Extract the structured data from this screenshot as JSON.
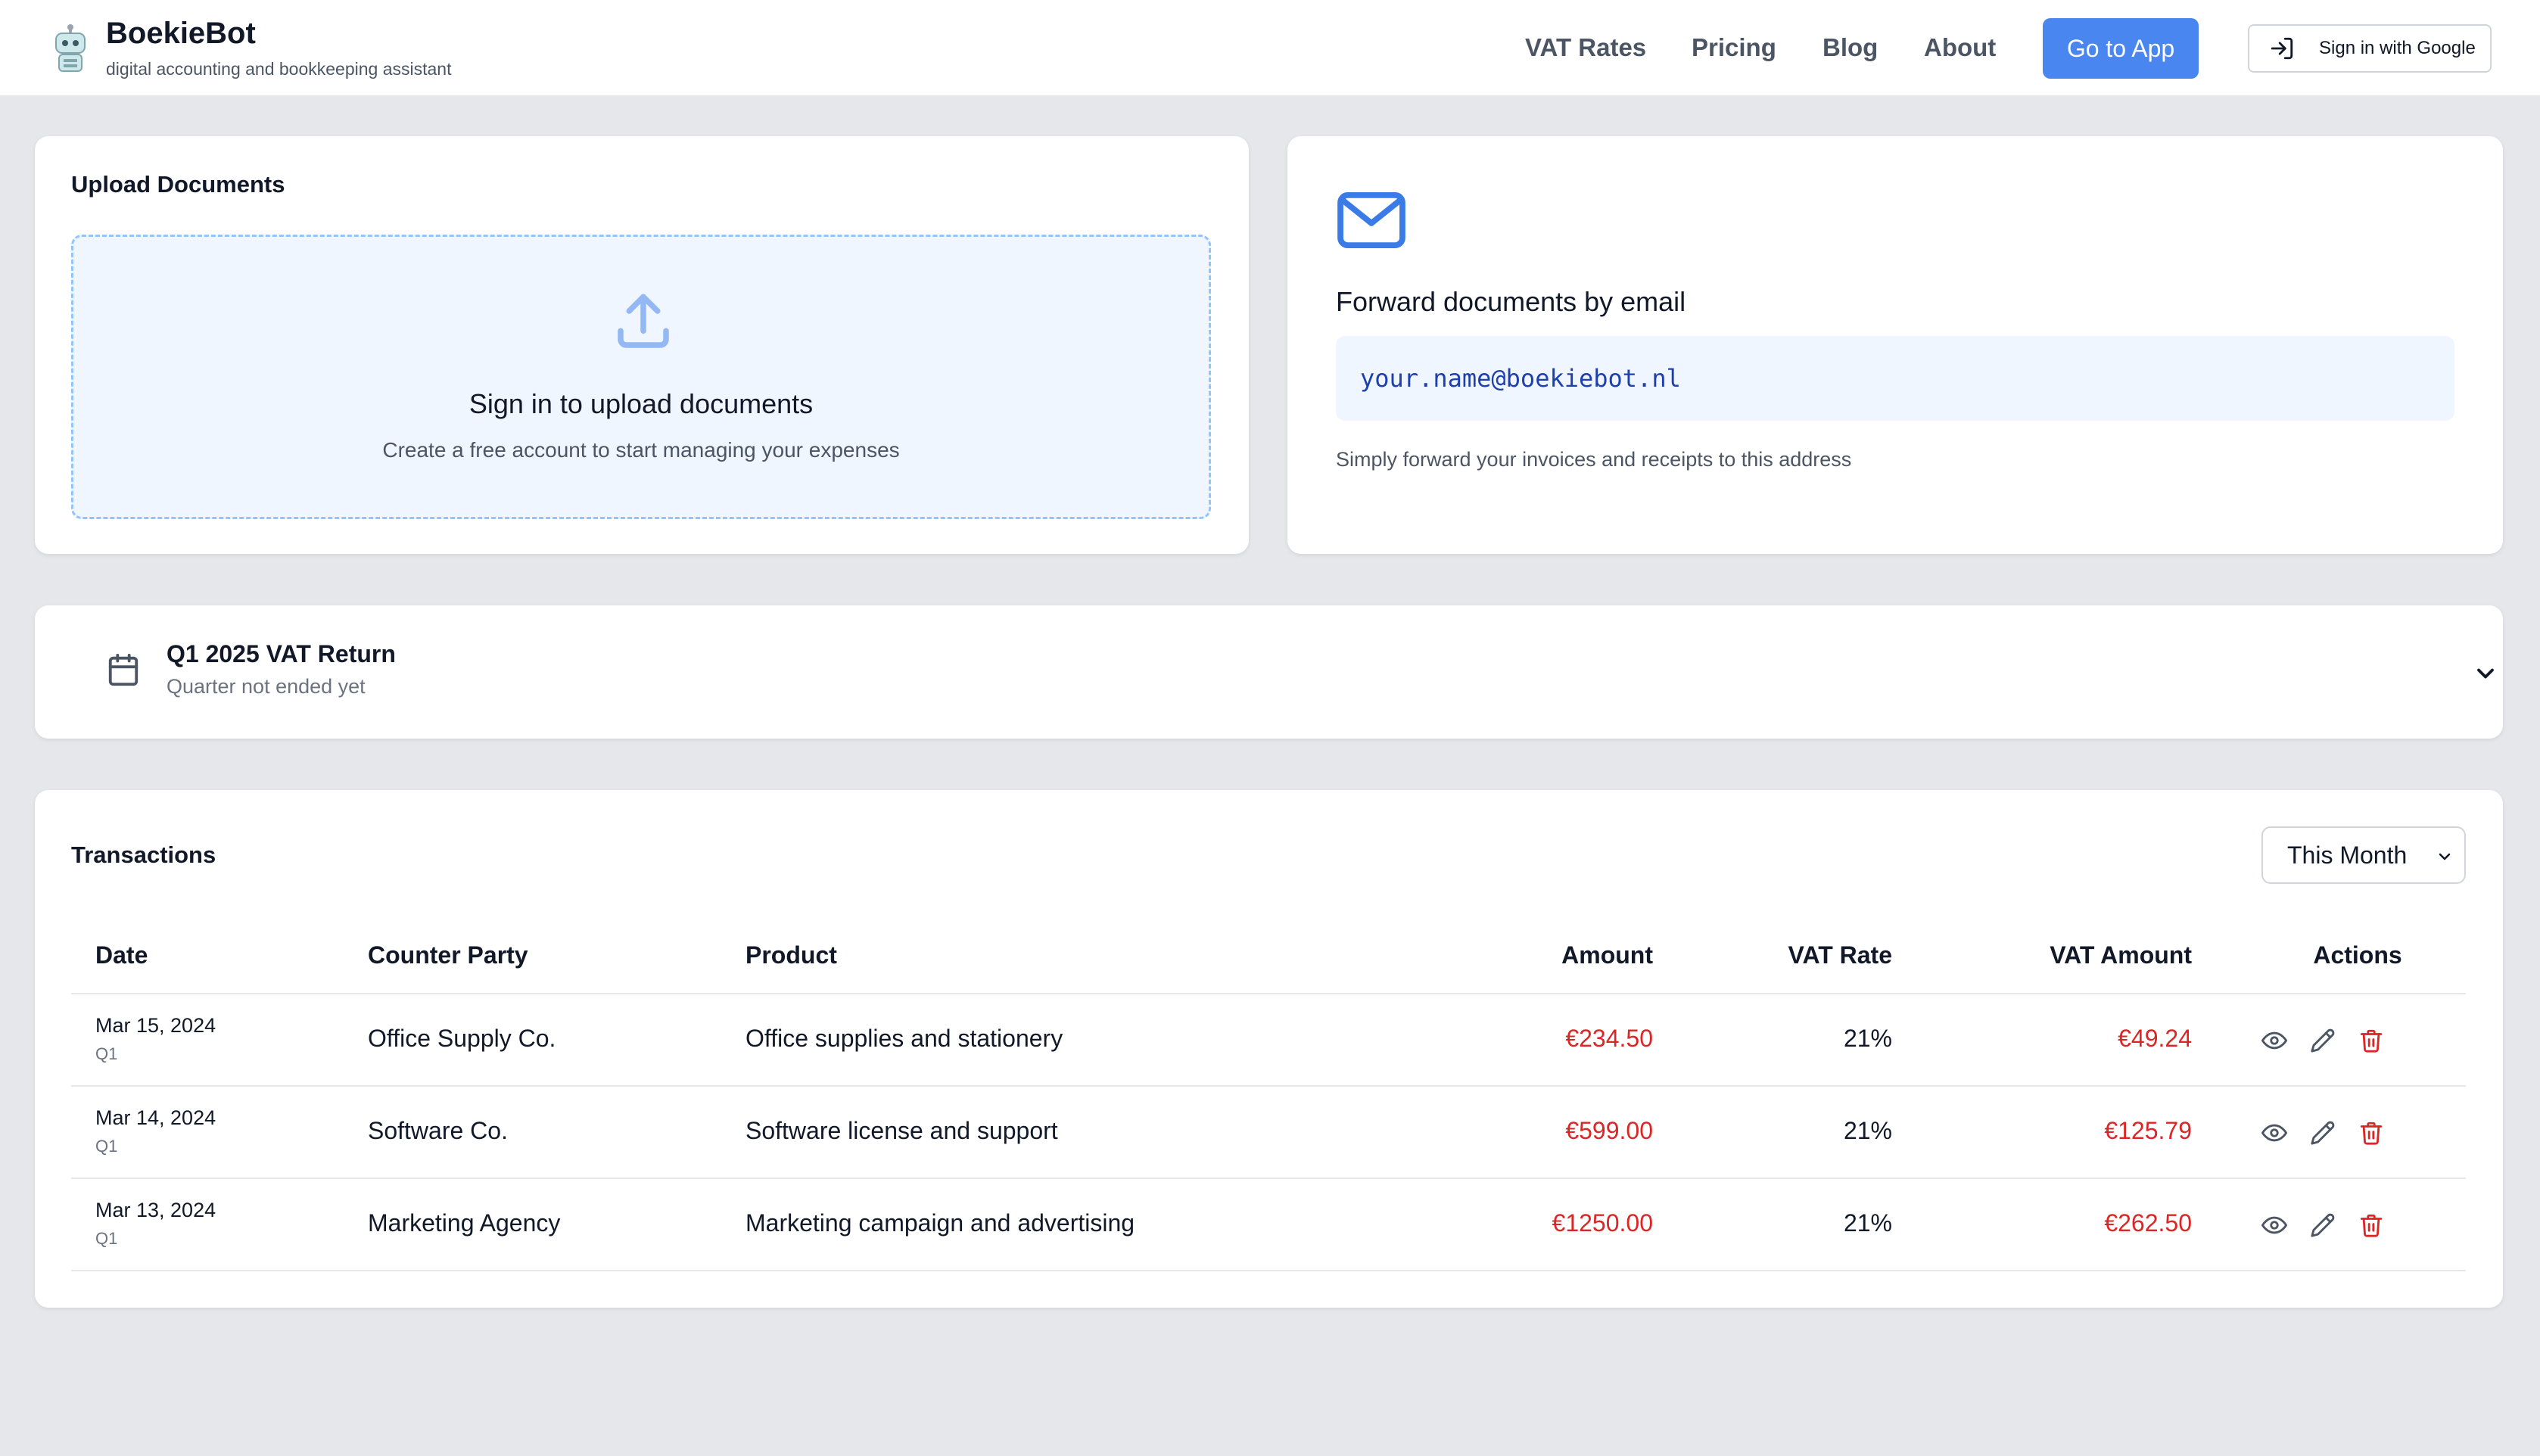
{
  "header": {
    "brand_title": "BoekieBot",
    "brand_subtitle": "digital accounting and bookkeeping assistant",
    "nav": [
      "VAT Rates",
      "Pricing",
      "Blog",
      "About"
    ],
    "go_to_app": "Go to App",
    "sign_in_google": "Sign in with Google"
  },
  "upload": {
    "title": "Upload Documents",
    "heading": "Sign in to upload documents",
    "subtext": "Create a free account to start managing your expenses"
  },
  "email_forward": {
    "title": "Forward documents by email",
    "address": "your.name@boekiebot.nl",
    "subtext": "Simply forward your invoices and receipts to this address"
  },
  "vat_return": {
    "title": "Q1 2025 VAT Return",
    "status": "Quarter not ended yet"
  },
  "transactions": {
    "title": "Transactions",
    "period": "This Month",
    "columns": [
      "Date",
      "Counter Party",
      "Product",
      "Amount",
      "VAT Rate",
      "VAT Amount",
      "Actions"
    ],
    "rows": [
      {
        "date": "Mar 15, 2024",
        "quarter": "Q1",
        "counter_party": "Office Supply Co.",
        "product": "Office supplies and stationery",
        "amount": "€234.50",
        "vat_rate": "21%",
        "vat_amount": "€49.24"
      },
      {
        "date": "Mar 14, 2024",
        "quarter": "Q1",
        "counter_party": "Software Co.",
        "product": "Software license and support",
        "amount": "€599.00",
        "vat_rate": "21%",
        "vat_amount": "€125.79"
      },
      {
        "date": "Mar 13, 2024",
        "quarter": "Q1",
        "counter_party": "Marketing Agency",
        "product": "Marketing campaign and advertising",
        "amount": "€1250.00",
        "vat_rate": "21%",
        "vat_amount": "€262.50"
      }
    ]
  },
  "colors": {
    "accent": "#4a86f0",
    "money": "#dc2626",
    "background": "#e5e7eb"
  }
}
